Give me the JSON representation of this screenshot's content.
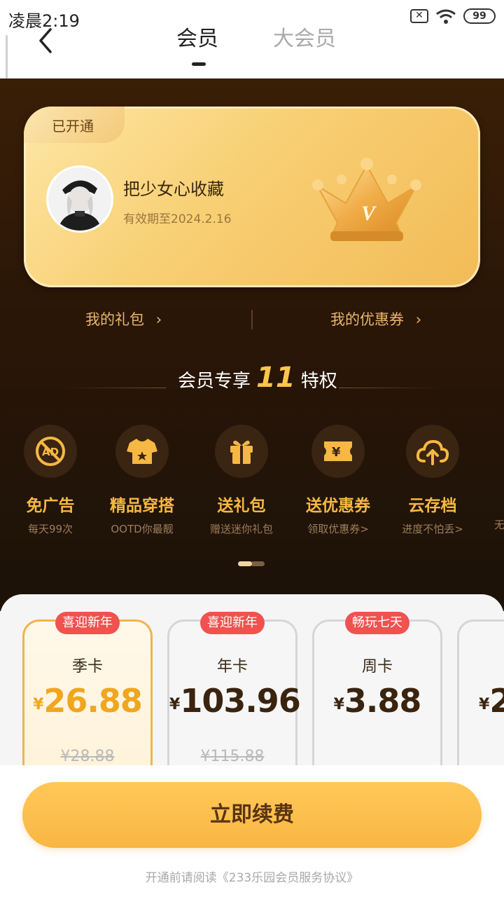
{
  "status_bar": {
    "time": "凌晨2:19",
    "battery": "99"
  },
  "nav": {
    "tabs": [
      "会员",
      "大会员"
    ],
    "active_tab": 0
  },
  "member_card": {
    "badge": "已开通",
    "nickname": "把少女心收藏",
    "expiry": "有效期至2024.2.16"
  },
  "links": {
    "gift": "我的礼包",
    "coupon": "我的优惠券"
  },
  "privileges": {
    "title_prefix": "会员专享",
    "count": "11",
    "title_suffix": "特权",
    "items": [
      {
        "icon": "no-ads-icon",
        "name": "免广告",
        "desc": "每天99次"
      },
      {
        "icon": "tshirt-icon",
        "name": "精品穿搭",
        "desc": "OOTD你最靓"
      },
      {
        "icon": "gift-icon",
        "name": "送礼包",
        "desc": "赠送迷你礼包"
      },
      {
        "icon": "coupon-icon",
        "name": "送优惠券",
        "desc": "领取优惠券>"
      },
      {
        "icon": "cloud-upload-icon",
        "name": "云存档",
        "desc": "进度不怕丢>"
      },
      {
        "icon": "partial-icon",
        "name": "",
        "desc": "无"
      }
    ]
  },
  "plans": [
    {
      "tag": "喜迎新年",
      "name": "季卡",
      "currency": "¥",
      "price": "26.88",
      "original": "¥28.88",
      "selected": true
    },
    {
      "tag": "喜迎新年",
      "name": "年卡",
      "currency": "¥",
      "price": "103.96",
      "original": "¥115.88",
      "selected": false
    },
    {
      "tag": "畅玩七天",
      "name": "周卡",
      "currency": "¥",
      "price": "3.88",
      "original": "",
      "selected": false
    },
    {
      "tag": "",
      "name": "",
      "currency": "¥",
      "price": "2",
      "original": "",
      "selected": false
    }
  ],
  "cta": {
    "label": "立即续费"
  },
  "agreement": "开通前请阅读《233乐园会员服务协议》",
  "colors": {
    "accent": "#f9b642",
    "brand_dark": "#2a1607",
    "tag_red": "#f0524f",
    "gold_text": "#f6b842"
  }
}
